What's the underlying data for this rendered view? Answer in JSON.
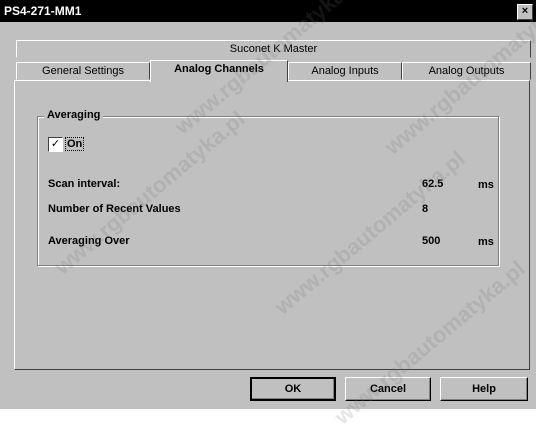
{
  "window": {
    "title": "PS4-271-MM1",
    "close_glyph": "×"
  },
  "tabs": {
    "top_row": "Suconet K Master",
    "bottom_row": [
      "General Settings",
      "Analog Channels",
      "Analog Inputs",
      "Analog Outputs"
    ],
    "selected": "Analog Channels"
  },
  "averaging": {
    "group_title": "Averaging",
    "checkbox_label": "On",
    "checkbox_checked": true,
    "checkbox_glyph": "✓",
    "rows": [
      {
        "label": "Scan interval:",
        "value": "62.5",
        "unit": "ms"
      },
      {
        "label": "Number of Recent Values",
        "value": "8",
        "unit": ""
      },
      {
        "label": "Averaging Over",
        "value": "500",
        "unit": "ms"
      }
    ]
  },
  "buttons": {
    "ok": "OK",
    "cancel": "Cancel",
    "help": "Help"
  },
  "watermark_text": "www.rgbautomatyka.pl"
}
